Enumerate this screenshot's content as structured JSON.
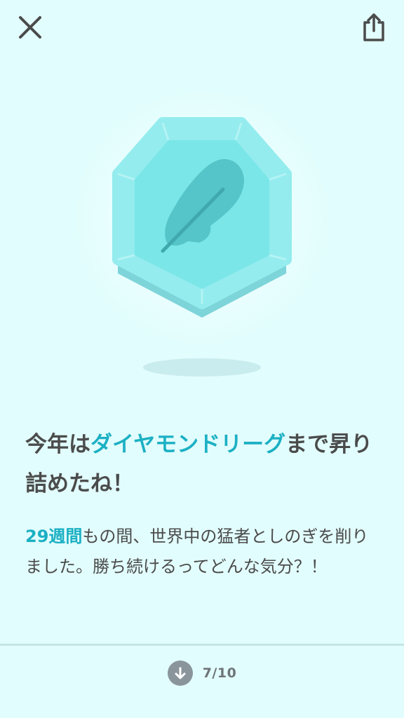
{
  "toolbar": {
    "close_icon": "close-icon",
    "share_icon": "share-icon"
  },
  "badge": {
    "icon": "feather-icon",
    "league_color": "#7ae6e8"
  },
  "headline": {
    "part1": "今年は",
    "highlight": "ダイヤモンドリーグ",
    "part2": "まで昇り詰めたね！"
  },
  "body": {
    "highlight": "29週間",
    "text": "もの間、世界中の猛者としのぎを削りました。勝ち続けるってどんな気分？！"
  },
  "pager": {
    "icon": "arrow-down-icon",
    "progress": "7/10"
  },
  "colors": {
    "background": "#e2fdfd",
    "accent": "#1cb0c4",
    "text": "#4b4b4b"
  }
}
